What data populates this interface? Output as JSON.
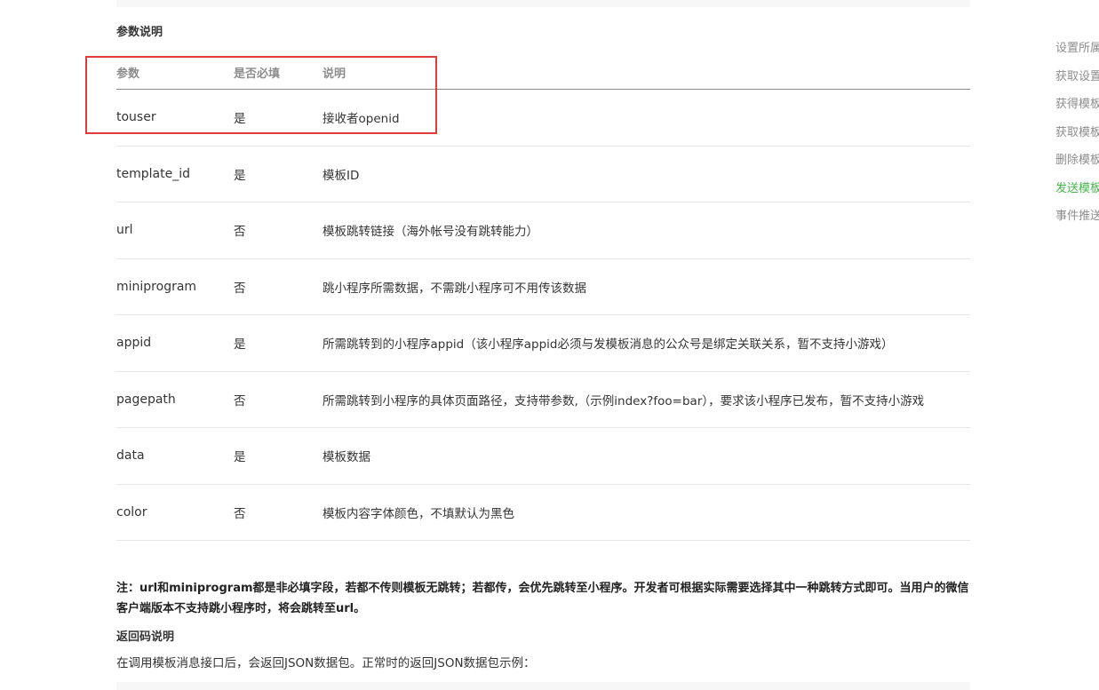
{
  "params_section": {
    "title": "参数说明",
    "headers": {
      "param": "参数",
      "required": "是否必填",
      "description": "说明"
    },
    "rows": [
      {
        "param": "touser",
        "required": "是",
        "description": "接收者openid"
      },
      {
        "param": "template_id",
        "required": "是",
        "description": "模板ID"
      },
      {
        "param": "url",
        "required": "否",
        "description": "模板跳转链接（海外帐号没有跳转能力）"
      },
      {
        "param": "miniprogram",
        "required": "否",
        "description": "跳小程序所需数据，不需跳小程序可不用传该数据"
      },
      {
        "param": "appid",
        "required": "是",
        "description": "所需跳转到的小程序appid（该小程序appid必须与发模板消息的公众号是绑定关联关系，暂不支持小游戏）"
      },
      {
        "param": "pagepath",
        "required": "否",
        "description": "所需跳转到小程序的具体页面路径，支持带参数,（示例index?foo=bar），要求该小程序已发布，暂不支持小游戏"
      },
      {
        "param": "data",
        "required": "是",
        "description": "模板数据"
      },
      {
        "param": "color",
        "required": "否",
        "description": "模板内容字体颜色，不填默认为黑色"
      }
    ]
  },
  "note": "注：url和miniprogram都是非必填字段，若都不传则模板无跳转；若都传，会优先跳转至小程序。开发者可根据实际需要选择其中一种跳转方式即可。当用户的微信客户端版本不支持跳小程序时，将会跳转至url。",
  "return_section": {
    "title": "返回码说明",
    "body": "在调用模板消息接口后，会返回JSON数据包。正常时的返回JSON数据包示例："
  },
  "right_nav": {
    "items": [
      {
        "label": "设置所属行业"
      },
      {
        "label": "获取设置的行业信息"
      },
      {
        "label": "获得模板ID"
      },
      {
        "label": "获取模板列表"
      },
      {
        "label": "删除模板"
      },
      {
        "label": "发送模板消息"
      },
      {
        "label": "事件推送"
      }
    ],
    "active_index": 5
  },
  "colors": {
    "highlight_border": "#e03c3c",
    "nav_active": "#44b549",
    "nav_default": "#8d8d8d"
  }
}
